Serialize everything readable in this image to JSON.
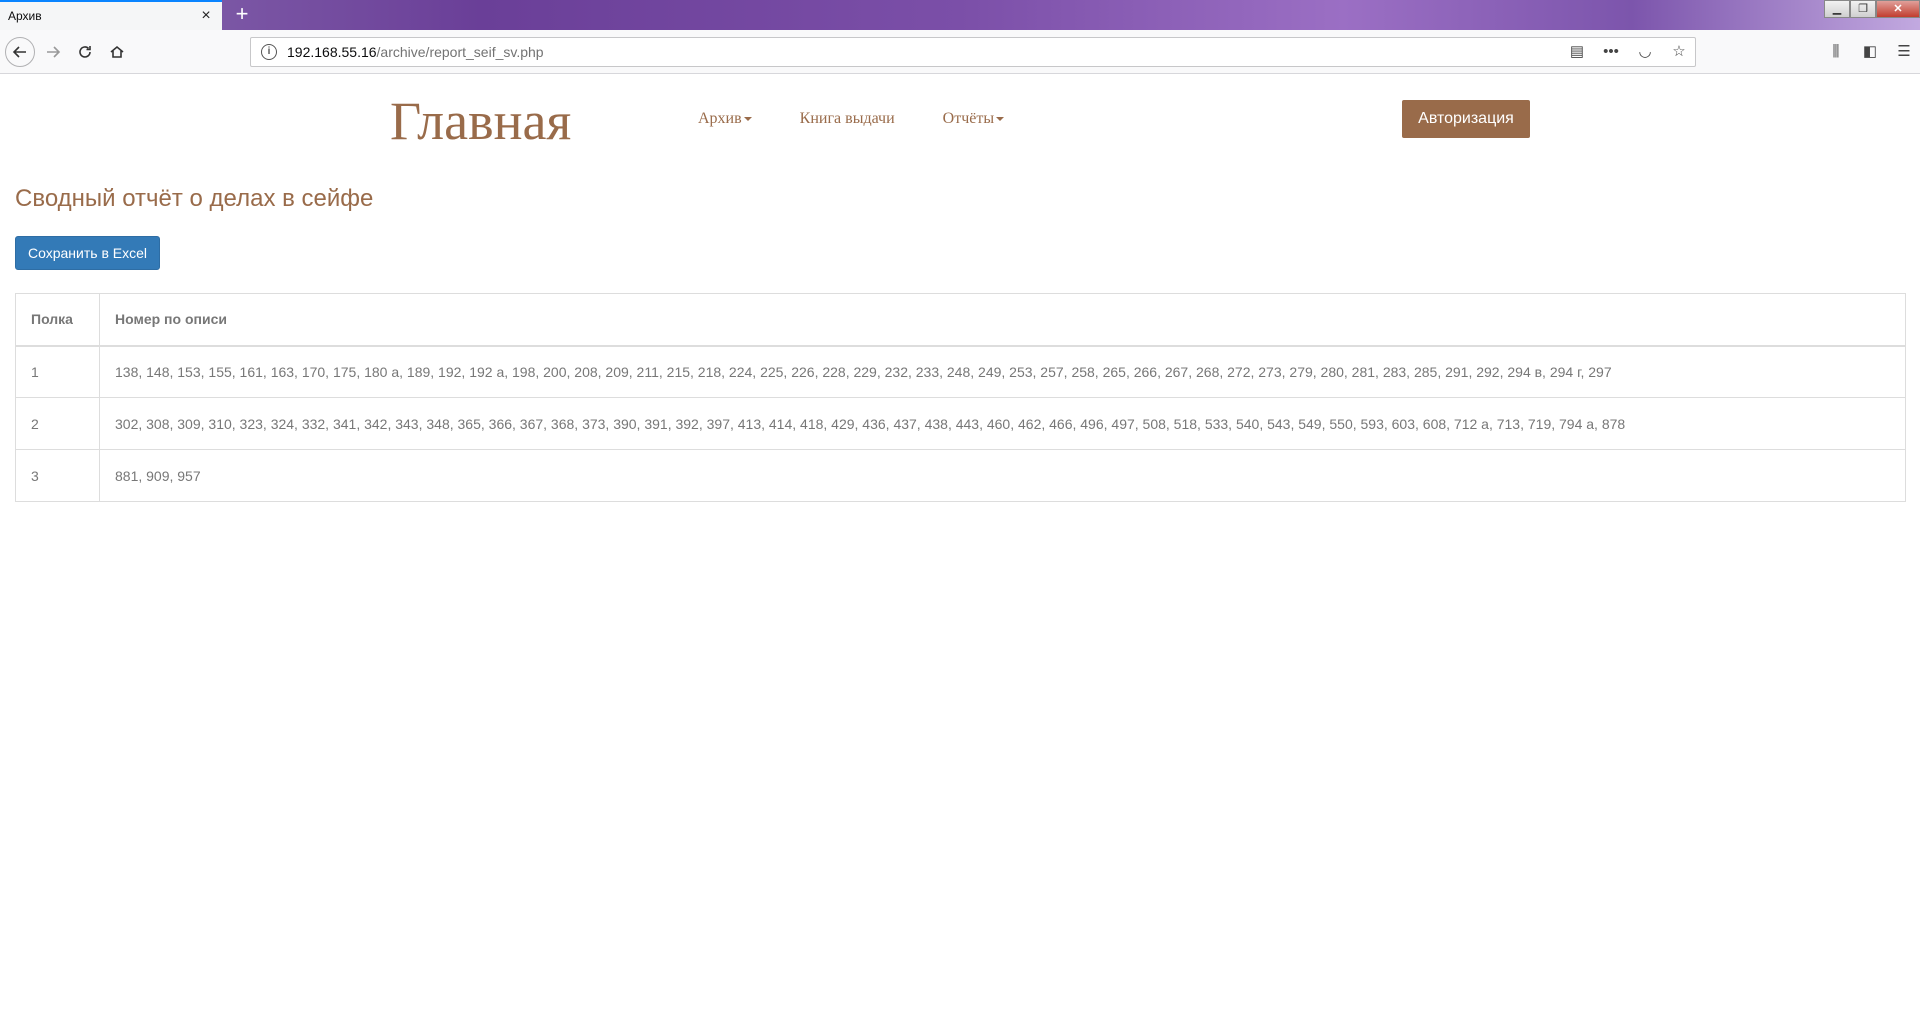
{
  "browser": {
    "tab_title": "Архив",
    "tab_close": "×",
    "new_tab": "+",
    "url_host": "192.168.55.16",
    "url_path": "/archive/report_seif_sv.php",
    "window_controls": [
      "▁",
      "❐",
      "✕"
    ]
  },
  "site": {
    "brand": "Главная",
    "menu": [
      {
        "label": "Архив",
        "dropdown": true
      },
      {
        "label": "Книга выдачи",
        "dropdown": false
      },
      {
        "label": "Отчёты",
        "dropdown": true
      }
    ],
    "auth_button": "Авторизация"
  },
  "report": {
    "title": "Сводный отчёт о делах в сейфе",
    "excel_button": "Сохранить в Excel",
    "headers": [
      "Полка",
      "Номер по описи"
    ],
    "rows": [
      {
        "shelf": "1",
        "numbers": "138, 148, 153, 155, 161, 163, 170, 175, 180 а, 189, 192, 192 а, 198, 200, 208, 209, 211, 215, 218, 224, 225, 226, 228, 229, 232, 233, 248, 249, 253, 257, 258, 265, 266, 267, 268, 272, 273, 279, 280, 281, 283, 285, 291, 292, 294 в, 294 г, 297"
      },
      {
        "shelf": "2",
        "numbers": "302, 308, 309, 310, 323, 324, 332, 341, 342, 343, 348, 365, 366, 367, 368, 373, 390, 391, 392, 397, 413, 414, 418, 429, 436, 437, 438, 443, 460, 462, 466, 496, 497, 508, 518, 533, 540, 543, 549, 550, 593, 603, 608, 712 а, 713, 719, 794 а, 878"
      },
      {
        "shelf": "3",
        "numbers": "881, 909, 957"
      }
    ]
  },
  "colors": {
    "brand": "#996b4a",
    "primary_button": "#337ab7",
    "text_muted": "#777777"
  }
}
